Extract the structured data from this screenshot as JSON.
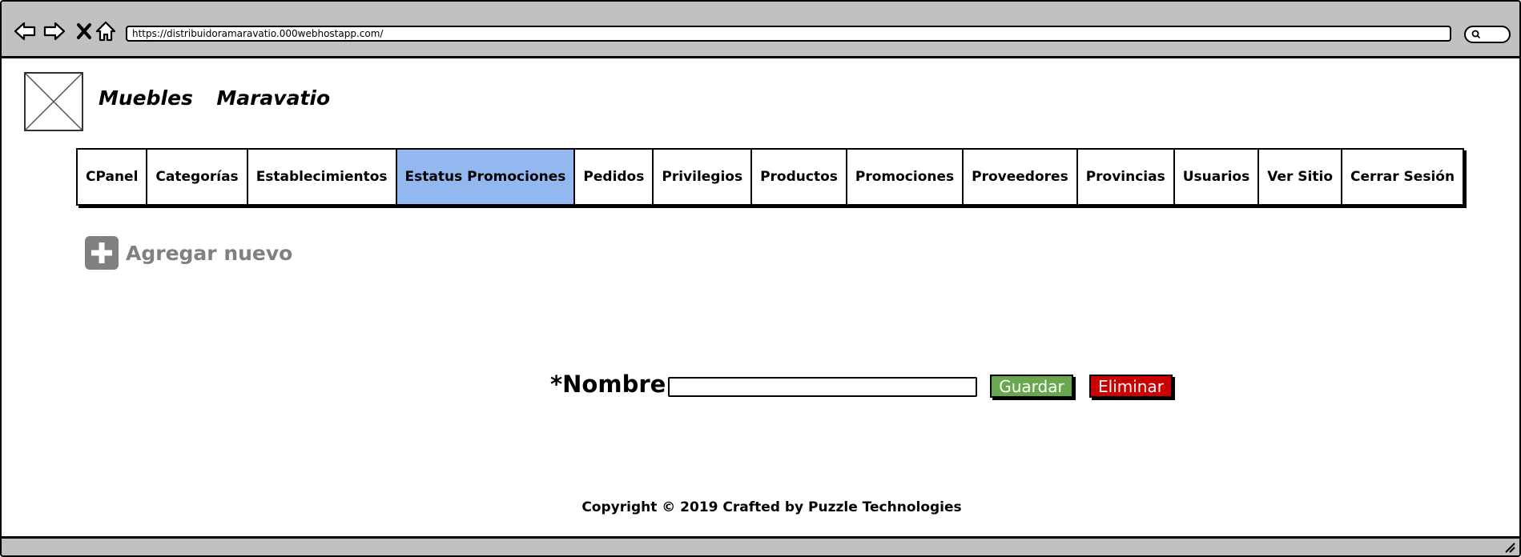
{
  "browser": {
    "url": "https://distribuidoramaravatio.000webhostapp.com/",
    "icons": [
      "back-icon",
      "forward-icon",
      "close-icon",
      "home-icon",
      "search-icon"
    ]
  },
  "header": {
    "site_title": "Muebles  Maravatio"
  },
  "menu": {
    "items": [
      {
        "label": "CPanel"
      },
      {
        "label": "Categorías"
      },
      {
        "label": "Establecimientos"
      },
      {
        "label": "Estatus Promociones",
        "active": true
      },
      {
        "label": "Pedidos"
      },
      {
        "label": "Privilegios"
      },
      {
        "label": "Productos"
      },
      {
        "label": "Promociones"
      },
      {
        "label": "Proveedores"
      },
      {
        "label": "Provincias"
      },
      {
        "label": "Usuarios"
      },
      {
        "label": "Ver Sitio"
      },
      {
        "label": "Cerrar Sesión"
      }
    ],
    "active_color": "#93b8f0"
  },
  "actions": {
    "add_new_label": "Agregar nuevo",
    "add_icon": "plus-icon"
  },
  "form": {
    "name_label": "*Nombre",
    "name_value": "",
    "save_label": "Guardar",
    "delete_label": "Eliminar",
    "save_color": "#6aa84f",
    "delete_color": "#cc0000"
  },
  "footer": {
    "copyright": "Copyright © 2019 Crafted by Puzzle Technologies"
  }
}
